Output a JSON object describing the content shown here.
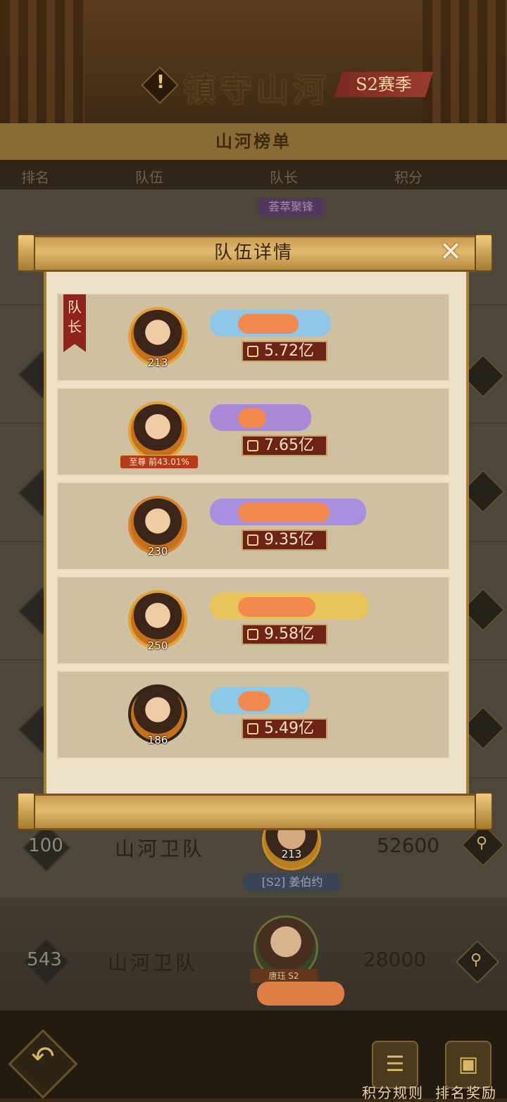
{
  "header": {
    "title": "镇守山河",
    "season_badge": "S2赛季",
    "board_title": "山河榜单"
  },
  "columns": {
    "rank": "排名",
    "team": "队伍",
    "captain": "队长",
    "score": "积分"
  },
  "behind_list": {
    "top_banner": "荟萃聚锋",
    "visible_row": {
      "rank": "100",
      "team": "山河卫队",
      "captain_level": "213",
      "captain_tag": "[S2] 姜伯约",
      "score": "52600"
    },
    "own_row": {
      "rank": "543",
      "team": "山河卫队",
      "captain_sub": "唐珏 S2",
      "score": "28000"
    }
  },
  "modal": {
    "title": "队伍详情",
    "close_icon": "close-icon",
    "captain_label": "队长",
    "members": [
      {
        "level": "213",
        "power": "5.72亿",
        "plate_color": "#8fc6ea",
        "ring_color": "#e3a12f",
        "title_tag": ""
      },
      {
        "level": "",
        "power": "7.65亿",
        "plate_color": "#a889d8",
        "ring_color": "#e3a12f",
        "title_tag": "至尊 前43.01%"
      },
      {
        "level": "230",
        "power": "9.35亿",
        "plate_color": "#a98fe0",
        "ring_color": "#d9822a",
        "title_tag": ""
      },
      {
        "level": "250",
        "power": "9.58亿",
        "plate_color": "#e8c45a",
        "ring_color": "#e3a12f",
        "title_tag": ""
      },
      {
        "level": "186",
        "power": "5.49亿",
        "plate_color": "#8cc8ea",
        "ring_color": "#2f2418",
        "title_tag": ""
      }
    ]
  },
  "bottom_bar": {
    "back_icon": "back-arrow-icon",
    "rules_label": "积分规则",
    "rewards_label": "排名奖励",
    "rules_icon": "scroll-icon",
    "rewards_icon": "treasure-chest-icon"
  }
}
